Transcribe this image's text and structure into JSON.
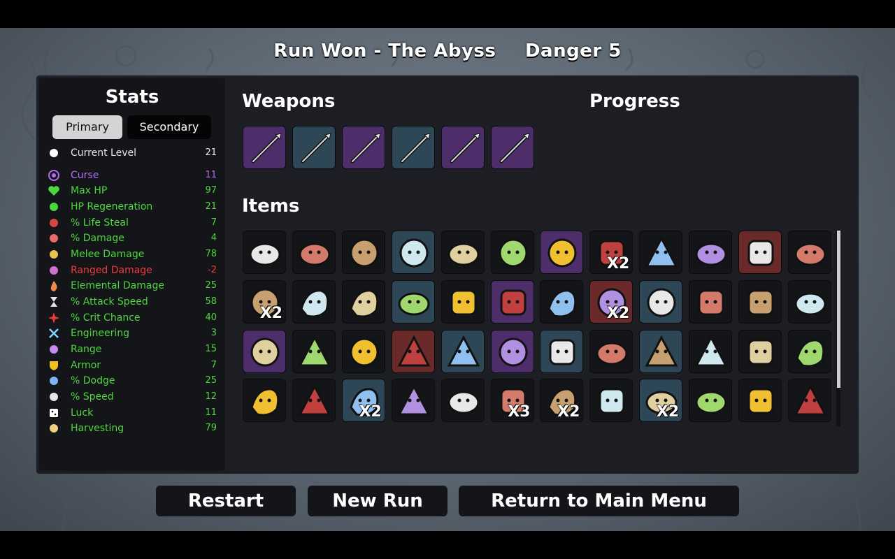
{
  "header": {
    "run_result": "Run Won - The Abyss",
    "danger": "Danger 5"
  },
  "stats": {
    "title": "Stats",
    "tabs": {
      "primary": "Primary",
      "secondary": "Secondary"
    },
    "rows": [
      {
        "label": "Current Level",
        "value": "21",
        "color": "#e6e6e6",
        "icon": "level-icon"
      },
      {
        "label": "Curse",
        "value": "11",
        "color": "#b36cf2",
        "icon": "curse-icon"
      },
      {
        "label": "Max HP",
        "value": "97",
        "color": "#4ed63f",
        "icon": "heart-icon"
      },
      {
        "label": "HP Regeneration",
        "value": "21",
        "color": "#4ed63f",
        "icon": "regen-icon"
      },
      {
        "label": "% Life Steal",
        "value": "7",
        "color": "#4ed63f",
        "icon": "lifesteal-icon"
      },
      {
        "label": "% Damage",
        "value": "4",
        "color": "#4ed63f",
        "icon": "damage-icon"
      },
      {
        "label": "Melee Damage",
        "value": "78",
        "color": "#4ed63f",
        "icon": "melee-icon"
      },
      {
        "label": "Ranged Damage",
        "value": "-2",
        "color": "#f03b3b",
        "icon": "ranged-icon"
      },
      {
        "label": "Elemental Damage",
        "value": "25",
        "color": "#4ed63f",
        "icon": "elemental-icon"
      },
      {
        "label": "% Attack Speed",
        "value": "58",
        "color": "#4ed63f",
        "icon": "hourglass-icon"
      },
      {
        "label": "% Crit Chance",
        "value": "40",
        "color": "#4ed63f",
        "icon": "crit-icon"
      },
      {
        "label": "Engineering",
        "value": "3",
        "color": "#4ed63f",
        "icon": "wrench-icon"
      },
      {
        "label": "Range",
        "value": "15",
        "color": "#4ed63f",
        "icon": "range-icon"
      },
      {
        "label": "Armor",
        "value": "7",
        "color": "#4ed63f",
        "icon": "shield-icon"
      },
      {
        "label": "% Dodge",
        "value": "25",
        "color": "#4ed63f",
        "icon": "dodge-icon"
      },
      {
        "label": "% Speed",
        "value": "12",
        "color": "#4ed63f",
        "icon": "speed-icon"
      },
      {
        "label": "Luck",
        "value": "11",
        "color": "#4ed63f",
        "icon": "dice-icon"
      },
      {
        "label": "Harvesting",
        "value": "79",
        "color": "#4ed63f",
        "icon": "harvest-icon"
      }
    ]
  },
  "weapons": {
    "title": "Weapons",
    "slots": [
      {
        "tier": 2,
        "icon": "spear-icon"
      },
      {
        "tier": 1,
        "icon": "spear-icon"
      },
      {
        "tier": 2,
        "icon": "spear-icon"
      },
      {
        "tier": 1,
        "icon": "spear-icon"
      },
      {
        "tier": 2,
        "icon": "spear-icon"
      },
      {
        "tier": 2,
        "icon": "spear-icon"
      }
    ]
  },
  "progress": {
    "title": "Progress"
  },
  "items": {
    "title": "Items",
    "slots": [
      {
        "tier": 0,
        "icon": "egg-face-icon",
        "qty": ""
      },
      {
        "tier": 0,
        "icon": "grabbing-hand-icon",
        "qty": ""
      },
      {
        "tier": 0,
        "icon": "cake-slice-icon",
        "qty": ""
      },
      {
        "tier": 1,
        "icon": "ninja-ball-icon",
        "qty": ""
      },
      {
        "tier": 0,
        "icon": "snowball-icon",
        "qty": ""
      },
      {
        "tier": 0,
        "icon": "ghost-icon",
        "qty": ""
      },
      {
        "tier": 2,
        "icon": "claw-marks-icon",
        "qty": ""
      },
      {
        "tier": 0,
        "icon": "scythe-icon",
        "qty": "X2"
      },
      {
        "tier": 0,
        "icon": "syringe-icon",
        "qty": ""
      },
      {
        "tier": 0,
        "icon": "dynamite-icon",
        "qty": ""
      },
      {
        "tier": 3,
        "icon": "potato-icon",
        "qty": ""
      },
      {
        "tier": 0,
        "icon": "flannel-shirt-icon",
        "qty": ""
      },
      {
        "tier": 0,
        "icon": "skull-icon",
        "qty": "X2"
      },
      {
        "tier": 0,
        "icon": "screaming-face-icon",
        "qty": ""
      },
      {
        "tier": 0,
        "icon": "eyes-icon",
        "qty": ""
      },
      {
        "tier": 1,
        "icon": "tentacle-icon",
        "qty": ""
      },
      {
        "tier": 0,
        "icon": "bucket-icon",
        "qty": ""
      },
      {
        "tier": 2,
        "icon": "bottle-icon",
        "qty": ""
      },
      {
        "tier": 0,
        "icon": "robot-arm-icon",
        "qty": ""
      },
      {
        "tier": 3,
        "icon": "gnome-icon",
        "qty": "X2"
      },
      {
        "tier": 1,
        "icon": "stone-icon",
        "qty": ""
      },
      {
        "tier": 0,
        "icon": "green-slime-icon",
        "qty": ""
      },
      {
        "tier": 0,
        "icon": "pencil-icon",
        "qty": ""
      },
      {
        "tier": 0,
        "icon": "propeller-hat-icon",
        "qty": ""
      },
      {
        "tier": 2,
        "icon": "scarf-icon",
        "qty": ""
      },
      {
        "tier": 0,
        "icon": "boxing-glove-icon",
        "qty": ""
      },
      {
        "tier": 0,
        "icon": "tooth-icon",
        "qty": ""
      },
      {
        "tier": 3,
        "icon": "mammoth-icon",
        "qty": ""
      },
      {
        "tier": 1,
        "icon": "treasure-map-icon",
        "qty": ""
      },
      {
        "tier": 2,
        "icon": "wings-icon",
        "qty": ""
      },
      {
        "tier": 1,
        "icon": "black-cloth-icon",
        "qty": ""
      },
      {
        "tier": 0,
        "icon": "injector-icon",
        "qty": ""
      },
      {
        "tier": 1,
        "icon": "glasses-icon",
        "qty": ""
      },
      {
        "tier": 0,
        "icon": "feather-icon",
        "qty": ""
      },
      {
        "tier": 0,
        "icon": "lizard-icon",
        "qty": ""
      },
      {
        "tier": 0,
        "icon": "palm-tree-icon",
        "qty": ""
      },
      {
        "tier": 0,
        "icon": "fish-icon",
        "qty": ""
      },
      {
        "tier": 0,
        "icon": "animal-skull-icon",
        "qty": ""
      },
      {
        "tier": 1,
        "icon": "boot-icon",
        "qty": "X2"
      },
      {
        "tier": 0,
        "icon": "target-dummy-icon",
        "qty": ""
      },
      {
        "tier": 0,
        "icon": "bee-icon",
        "qty": ""
      },
      {
        "tier": 0,
        "icon": "monkey-icon",
        "qty": "X3"
      },
      {
        "tier": 0,
        "icon": "coal-icon",
        "qty": "X2"
      },
      {
        "tier": 0,
        "icon": "slime-stack-icon",
        "qty": ""
      },
      {
        "tier": 1,
        "icon": "sausages-icon",
        "qty": "X2"
      },
      {
        "tier": 0,
        "icon": "landmine-icon",
        "qty": ""
      },
      {
        "tier": 0,
        "icon": "helmet-icon",
        "qty": ""
      },
      {
        "tier": 0,
        "icon": "whistle-icon",
        "qty": ""
      }
    ]
  },
  "buttons": {
    "restart": "Restart",
    "new_run": "New Run",
    "main_menu": "Return to Main Menu"
  },
  "colors": {
    "tier1": "#2d4757",
    "tier2": "#4d2d6a",
    "tier3": "#6a2a2a",
    "panel": "#1d1e23"
  }
}
